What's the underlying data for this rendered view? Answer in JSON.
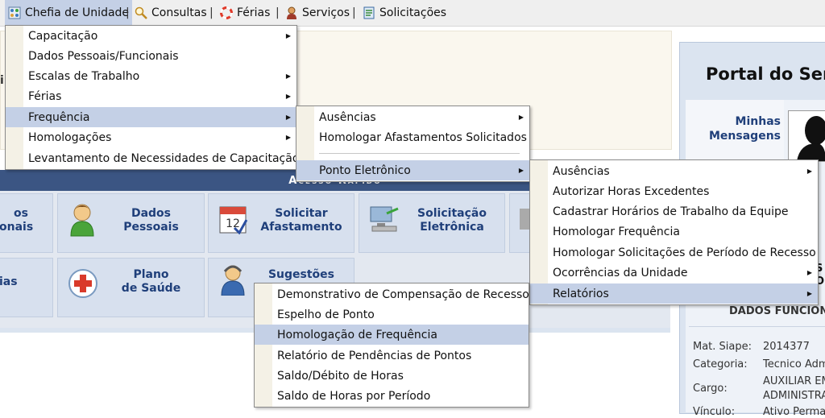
{
  "menubar": {
    "items": [
      {
        "label": "Chefia de Unidade",
        "icon": "chefia-icon"
      },
      {
        "label": "Consultas",
        "icon": "magnifier-icon"
      },
      {
        "label": "Férias",
        "icon": "lifebuoy-icon"
      },
      {
        "label": "Serviços",
        "icon": "person-icon"
      },
      {
        "label": "Solicitações",
        "icon": "document-icon"
      }
    ],
    "separator": "|"
  },
  "menu_chefia": {
    "items": [
      {
        "label": "Capacitação",
        "submenu": true
      },
      {
        "label": "Dados Pessoais/Funcionais",
        "submenu": false
      },
      {
        "label": "Escalas de Trabalho",
        "submenu": true
      },
      {
        "label": "Férias",
        "submenu": true
      },
      {
        "label": "Frequência",
        "submenu": true
      },
      {
        "label": "Homologações",
        "submenu": true
      },
      {
        "label": "Levantamento de Necessidades de Capacitação",
        "submenu": false
      }
    ]
  },
  "menu_frequencia": {
    "items": [
      {
        "label": "Ausências",
        "submenu": true
      },
      {
        "label": "Homologar Afastamentos Solicitados",
        "submenu": false
      },
      {
        "label": "Ponto Eletrônico",
        "submenu": true
      }
    ]
  },
  "menu_ponto": {
    "items": [
      {
        "label": "Ausências",
        "submenu": true
      },
      {
        "label": "Autorizar Horas Excedentes",
        "submenu": false
      },
      {
        "label": "Cadastrar Horários de Trabalho da Equipe",
        "submenu": false
      },
      {
        "label": "Homologar Frequência",
        "submenu": false
      },
      {
        "label": "Homologar Solicitações de Período de Recesso",
        "submenu": false
      },
      {
        "label": "Ocorrências da Unidade",
        "submenu": true
      },
      {
        "label": "Relatórios",
        "submenu": true
      }
    ]
  },
  "menu_relatorios": {
    "items": [
      {
        "label": "Demonstrativo de Compensação de Recesso"
      },
      {
        "label": "Espelho de Ponto"
      },
      {
        "label": "Homologação de Frequência"
      },
      {
        "label": "Relatório de Pendências de Pontos"
      },
      {
        "label": "Saldo/Débito de Horas"
      },
      {
        "label": "Saldo de Horas por Período"
      }
    ]
  },
  "background": {
    "left_fragment": "i",
    "acesso_rapido": "Acesso Rápido",
    "tiles": {
      "t1": {
        "l1": "os",
        "l2": "onais"
      },
      "t2": {
        "l1": "Dados",
        "l2": "Pessoais"
      },
      "t3": {
        "l1": "Solicitar",
        "l2": "Afastamento"
      },
      "t4": {
        "l1": "Solicitação",
        "l2": "Eletrônica"
      },
      "t5": {
        "l1": "ias"
      },
      "t6": {
        "l1": "Plano",
        "l2": "de Saúde"
      },
      "t7": {
        "l1": "Sugestões"
      }
    }
  },
  "portal": {
    "title": "Portal do Ser",
    "msg_l1": "Minhas",
    "msg_l2": "Mensagens",
    "side_frag1": "S",
    "side_frag2": "O",
    "dados_header": "DADOS FUNCIONA",
    "rows": [
      {
        "label": "Mat. Siape:",
        "value": "2014377"
      },
      {
        "label": "Categoria:",
        "value": "Tecnico Adm"
      },
      {
        "label": "Cargo:",
        "value": "AUXILIAR EM",
        "value2": "ADMINISTRAC"
      },
      {
        "label": "Vínculo:",
        "value": "Ativo Perma"
      }
    ]
  },
  "colors": {
    "highlight": "#c4d0e6",
    "header_blue": "#3b5583",
    "link_blue": "#1f3f7a"
  }
}
